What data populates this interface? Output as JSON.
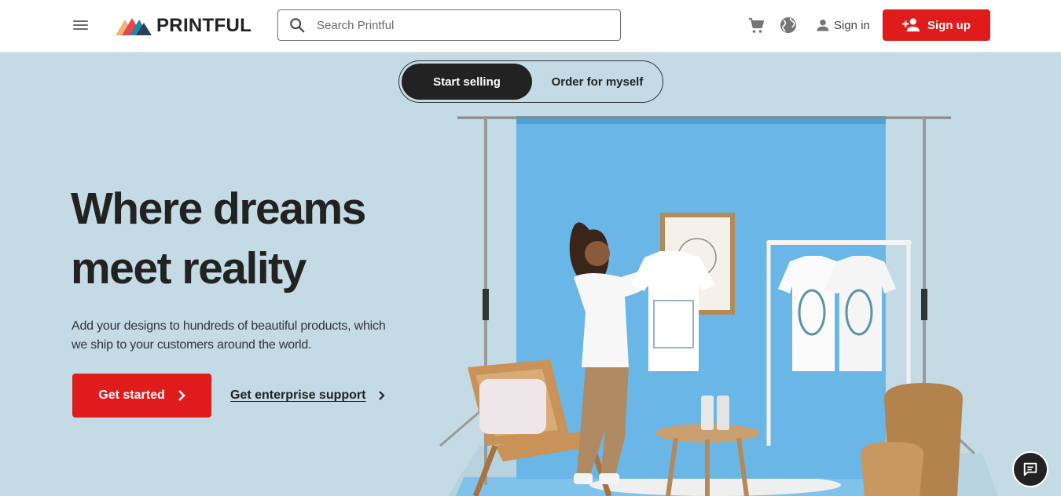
{
  "header": {
    "menu_icon": "hamburger-menu-icon",
    "logo_text": "PRINTFUL",
    "search": {
      "placeholder": "Search Printful",
      "value": "",
      "icon": "search-icon"
    },
    "cart_icon": "cart-icon",
    "globe_icon": "globe-icon",
    "signin_label": "Sign in",
    "signup_label": "Sign up"
  },
  "toggle": {
    "active_label": "Start selling",
    "inactive_label": "Order for myself"
  },
  "hero": {
    "headline_line1": "Where dreams",
    "headline_line2": "meet reality",
    "subtext": "Add your designs to hundreds of beautiful products, which we ship to your customers around the world.",
    "cta_primary": "Get started",
    "cta_secondary": "Get enterprise support"
  },
  "chat_icon": "chat-bubble-icon",
  "colors": {
    "brand_red": "#e01b1b",
    "hero_bg": "#c4dbe6",
    "backdrop_blue": "#6ab6e6",
    "dark": "#222222"
  }
}
